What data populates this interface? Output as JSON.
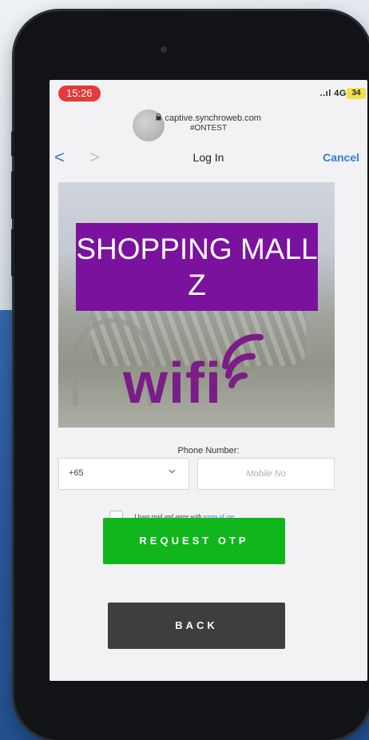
{
  "status_bar": {
    "time": "15:26",
    "signal": "..ıl 4G",
    "battery": "34"
  },
  "browser": {
    "url": "captive.synchroweb.com",
    "url_sub": "#ONTEST",
    "nav_title": "Log In",
    "cancel_label": "Cancel",
    "back_glyph": "<",
    "forward_glyph": ">"
  },
  "hero": {
    "brand_name": "SHOPPING MALL Z",
    "wifi_text": "wifi",
    "colors": {
      "brand_bg": "#7b129e",
      "wifi": "#7a1d86"
    }
  },
  "form": {
    "phone_label": "Phone Number:",
    "country_code": "+65",
    "mobile_placeholder": "Mobile No",
    "terms_prefix": "I have read and agree with",
    "terms_link": "terms of use"
  },
  "buttons": {
    "request_otp": "REQUEST OTP",
    "back": "BACK",
    "colors": {
      "request_otp": "#11b51c",
      "back": "#403d40"
    }
  },
  "icons": {
    "lock": "lock-icon",
    "chevron": "chevron-down-icon",
    "wifi": "wifi-icon"
  }
}
